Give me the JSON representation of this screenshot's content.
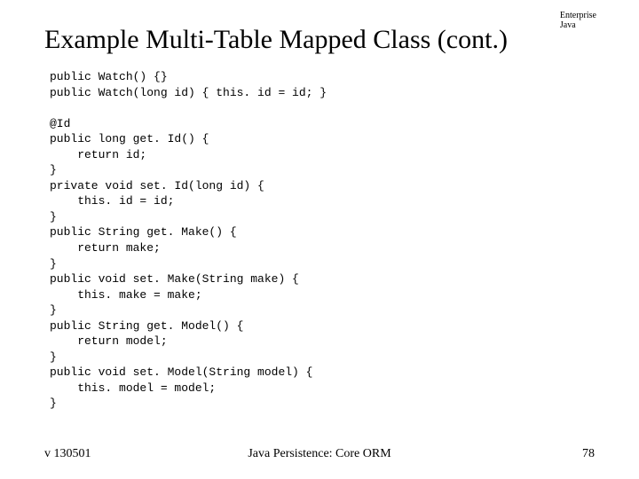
{
  "corner": {
    "line1": "Enterprise",
    "line2": "Java"
  },
  "title": "Example Multi-Table Mapped Class (cont.)",
  "code": "public Watch() {}\npublic Watch(long id) { this. id = id; }\n\n@Id\npublic long get. Id() {\n    return id;\n}\nprivate void set. Id(long id) {\n    this. id = id;\n}\npublic String get. Make() {\n    return make;\n}\npublic void set. Make(String make) {\n    this. make = make;\n}\npublic String get. Model() {\n    return model;\n}\npublic void set. Model(String model) {\n    this. model = model;\n}",
  "footer": {
    "left": "v 130501",
    "center": "Java Persistence: Core ORM",
    "right": "78"
  }
}
